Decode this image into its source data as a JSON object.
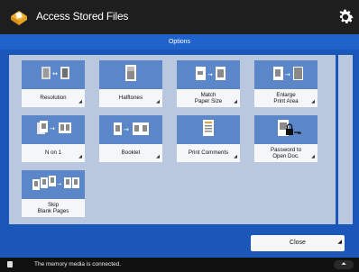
{
  "app": {
    "title": "Access Stored Files"
  },
  "header": {
    "section": "Options"
  },
  "tiles": [
    {
      "label": "Resolution",
      "icon": "resolution-icon"
    },
    {
      "label": "Halftones",
      "icon": "halftones-icon"
    },
    {
      "label": "Match\nPaper Size",
      "icon": "match-paper-size-icon"
    },
    {
      "label": "Enlarge\nPrint Area",
      "icon": "enlarge-print-area-icon"
    },
    {
      "label": "N on 1",
      "icon": "n-on-1-icon"
    },
    {
      "label": "Booklet",
      "icon": "booklet-icon"
    },
    {
      "label": "Print Comments",
      "icon": "print-comments-icon"
    },
    {
      "label": "Password to\nOpen Doc.",
      "icon": "password-icon"
    },
    {
      "label": "Skip\nBlank Pages",
      "icon": "skip-blank-pages-icon"
    }
  ],
  "footer": {
    "close_label": "Close"
  },
  "status": {
    "message": "The memory media is connected."
  },
  "colors": {
    "titlebar": "#1e1e1e",
    "blue": "#1a57b8",
    "tile_top": "#5b87c9",
    "panel": "#b9c8de"
  }
}
